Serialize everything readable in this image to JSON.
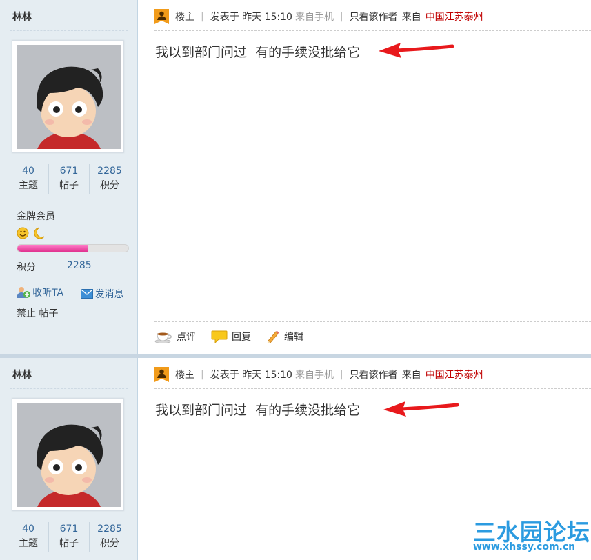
{
  "posts": [
    {
      "author": "林林",
      "stats": [
        {
          "value": "40",
          "label": "主题"
        },
        {
          "value": "671",
          "label": "帖子"
        },
        {
          "value": "2285",
          "label": "积分"
        }
      ],
      "rank": "金牌会员",
      "progress": 0.64,
      "credit_label": "积分",
      "credit_value": "2285",
      "follow": "收听TA",
      "message": "发消息",
      "ban": "禁止 帖子",
      "owner_label": "楼主",
      "posted": "发表于 昨天 15:10",
      "source": "来自手机",
      "only_author": "只看该作者",
      "from_label": "来自",
      "location": "中国江苏泰州",
      "content": "我以到部门问过  有的手续没批给它",
      "footer": {
        "comment": "点评",
        "reply": "回复",
        "edit": "编辑"
      }
    },
    {
      "author": "林林",
      "stats": [
        {
          "value": "40",
          "label": "主题"
        },
        {
          "value": "671",
          "label": "帖子"
        },
        {
          "value": "2285",
          "label": "积分"
        }
      ],
      "owner_label": "楼主",
      "posted": "发表于 昨天 15:10",
      "source": "来自手机",
      "only_author": "只看该作者",
      "from_label": "来自",
      "location": "中国江苏泰州",
      "content": "我以到部门问过  有的手续没批给它"
    }
  ],
  "watermark": {
    "title": "三水园论坛",
    "url": "www.xhssy.com.cn"
  },
  "colors": {
    "sidebar_bg": "#e5edf2",
    "link": "#336699",
    "location": "#c00000",
    "arrow": "#e8191c",
    "watermark": "#2b9be0"
  },
  "icons": [
    "avatar-cartoon-boy",
    "moon-icon",
    "smiley-icon",
    "follow-icon",
    "mail-icon",
    "owner-badge-icon",
    "coffee-icon",
    "speech-bubble-icon",
    "pencil-icon",
    "red-arrow"
  ]
}
